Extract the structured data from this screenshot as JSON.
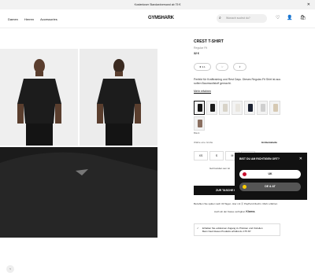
{
  "promo": {
    "text": "Kostenloser Standardversand ab 75 €",
    "close": "✕"
  },
  "nav": {
    "items": [
      "Damen",
      "Herren",
      "Accessories"
    ]
  },
  "logo": "GYMSHARK",
  "search": {
    "placeholder": "Wonach suchst du?"
  },
  "header_icons": {
    "wishlist": "♡",
    "account": "👤",
    "bag": "🛍"
  },
  "product": {
    "title": "CREST T-SHIRT",
    "fit": "Regular Fit",
    "price": "32 €",
    "rating": "4.1",
    "description": "Perfekt für Krafttraining und Rest Days. Dieses Regular-Fit Shirt ist aus soften Baumwollstoff gemacht.",
    "more": "Mehr erfahren",
    "color_name": "Black",
    "size_hint": "Wähle eine Größe",
    "size_guide": "Größentabelle",
    "sizes": [
      "XS",
      "S",
      "M",
      "L"
    ],
    "stock_note": "Geh kunden sen ist",
    "cart_button": "ZUR TASCHE HINZUFÜGEN",
    "paypal_note": "Bezahlen Sie später nach 30 Tagen. Hier mit ⓟ PayPal & Rechn. Mehr erfahren",
    "klarna_note": "Auch ab der Kasse verfügbar.",
    "klarna": "Klarna.",
    "member_title": "Erhalten Sie exklusiven Zugang zu Prämien und Vorteilen",
    "member_sub": "Beim Kauf dieses Produkts erhältst du 175 XP"
  },
  "swatch_colors": [
    "#151515",
    "#1c1c1c",
    "#d8d3c8",
    "#e9e6e0",
    "#1a2030",
    "#cfcfcf",
    "#d6c9b3",
    "#8a6f60"
  ],
  "modal": {
    "question": "BIST DU AM RICHTIGEN ORT?",
    "close": "✕",
    "option1": "UK",
    "option2": "DE & AT"
  },
  "gallery_prev": "‹"
}
